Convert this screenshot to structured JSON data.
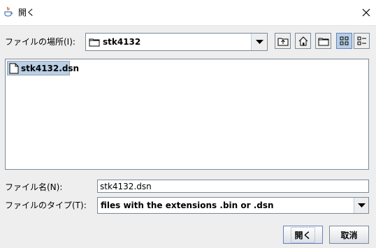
{
  "window": {
    "title": "開く"
  },
  "location": {
    "label": "ファイルの場所(I):",
    "value": "stk4132"
  },
  "toolbar": {
    "icons": [
      "up-one-level-icon",
      "home-icon",
      "new-folder-icon",
      "list-view-icon",
      "details-view-icon"
    ]
  },
  "files": [
    {
      "name": "stk4132.dsn",
      "selected": true
    }
  ],
  "filename": {
    "label": "ファイル名(N):",
    "value": "stk4132.dsn"
  },
  "filetype": {
    "label": "ファイルのタイプ(T):",
    "value": "files with the extensions .bin or  .dsn"
  },
  "buttons": {
    "open": "開く",
    "cancel": "取消"
  },
  "colors": {
    "selection": "#b8cfe5",
    "border": "#7a8a99",
    "background": "#eeeeee"
  }
}
